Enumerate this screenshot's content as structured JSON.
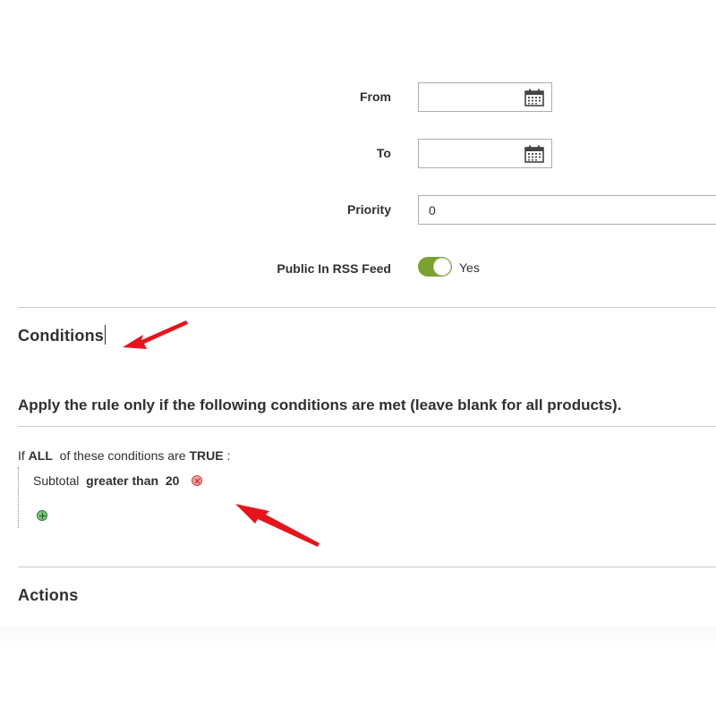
{
  "form": {
    "from_label": "From",
    "to_label": "To",
    "priority_label": "Priority",
    "priority_value": "0",
    "rss_label": "Public In RSS Feed",
    "rss_toggle_text": "Yes",
    "rss_enabled": true
  },
  "conditions": {
    "title": "Conditions",
    "legend": "Apply the rule only if the following conditions are met (leave blank for all products).",
    "rule_prefix": "If",
    "aggregator": "ALL",
    "rule_middle": "of these conditions are",
    "value": "TRUE",
    "rule_suffix": ":",
    "items": [
      {
        "attribute": "Subtotal",
        "operator": "greater than",
        "value": "20"
      }
    ]
  },
  "actions": {
    "title": "Actions"
  },
  "colors": {
    "toggle_on": "#79a22e",
    "annotation_arrow": "#e8141b",
    "divider": "#cccccc"
  }
}
